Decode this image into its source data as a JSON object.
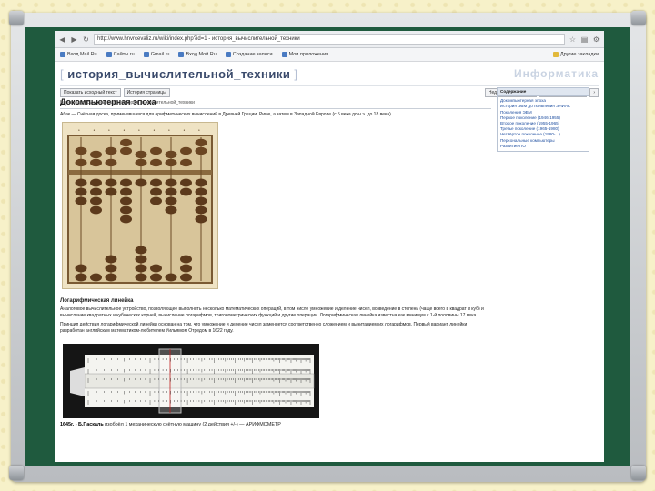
{
  "browser": {
    "url": "http://www.hnvrcevaliz.ru/wiki/index.php?id=1 - история_вычислительной_техники",
    "bookmarks": [
      "Вход Mail.Ru",
      "Сайты.ru",
      "Gmail.ru",
      "Вход.Мой.Ru",
      "Создание записи",
      "Мои приложения"
    ],
    "bookmarks_right": "Другие закладки"
  },
  "wiki": {
    "title": "история_вычислительной_техники",
    "brand": "Информатика",
    "toolbar": [
      "Показать исходный текст",
      "История страницы"
    ],
    "search_label": "Недавние изменения",
    "breadcrumbs": "Вы находитесь здесь: start » история_вычислительной_техники"
  },
  "sidebar": {
    "header": "Содержание",
    "items": [
      "Докомпьютерная эпоха",
      "История ЭВМ до появления ЭНИАК",
      "Поколения ЭВМ",
      "Первое поколение (1946-1955)",
      "Второе поколение (1955-1965)",
      "Третье поколение (1965-1980)",
      "Четвёртое поколение (1980-...)",
      "Персональные компьютеры",
      "Развитие ПО"
    ]
  },
  "content": {
    "heading": "Докомпьютерная эпоха",
    "abacus_line": "Абак — Счётная доска, применявшаяся для арифметических вычислений в Древней Греции, Риме, а затем в Западной Европе (с 5 века до н.э. до 18 века).",
    "abacus_label": "Абак",
    "section2": "Логарифмическая линейка",
    "section2_text": "Аналоговое вычислительное устройство, позволяющее выполнять несколько математических операций, в том числе умножение и деление чисел, возведение в степень (чаще всего в квадрат и куб) и вычисление квадратных и кубических корней, вычисление логарифмов, тригонометрических функций и другие операции. Логарифмическая линейка известна как минимум с 1-й половины 17 века.",
    "section2_text2": "Принцип действия логарифмической линейки основан на том, что умножение и деление чисел заменяется соответственно сложением и вычитанием их логарифмов. Первый вариант линейки разработан английским математиком-любителем Уильямом Отредом в 1622 году.",
    "caption_bold": "1645г. - Б.Паскаль",
    "caption_rest": " изобрёл 1 механическую счётную машину (2 действия +/-) — АРИФМОМЕТР"
  }
}
